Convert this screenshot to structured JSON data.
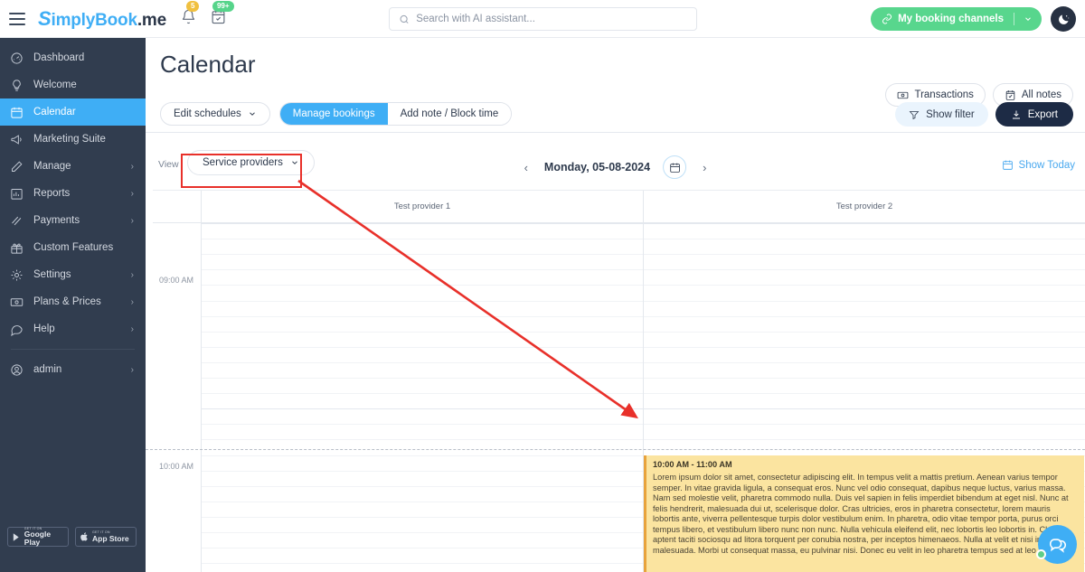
{
  "topbar": {
    "menu_icon": "hamburger-icon",
    "brand_s": "S",
    "brand_part1": "implyBook",
    "brand_part2": ".me",
    "bell_badge": "5",
    "calendar_badge": "99+",
    "search": {
      "placeholder": "Search with AI assistant...",
      "value": ""
    },
    "booking_channels_label": "My booking channels",
    "theme_toggle_icon": "moon-icon"
  },
  "sidebar": {
    "items": [
      {
        "label": "Dashboard",
        "icon": "gauge-icon",
        "active": false,
        "chevron": false
      },
      {
        "label": "Welcome",
        "icon": "bulb-icon",
        "active": false,
        "chevron": false
      },
      {
        "label": "Calendar",
        "icon": "calendar-icon",
        "active": true,
        "chevron": false
      },
      {
        "label": "Marketing Suite",
        "icon": "megaphone-icon",
        "active": false,
        "chevron": false
      },
      {
        "label": "Manage",
        "icon": "pencil-icon",
        "active": false,
        "chevron": true
      },
      {
        "label": "Reports",
        "icon": "chart-icon",
        "active": false,
        "chevron": true
      },
      {
        "label": "Payments",
        "icon": "coins-icon",
        "active": false,
        "chevron": true
      },
      {
        "label": "Custom Features",
        "icon": "gift-icon",
        "active": false,
        "chevron": false
      },
      {
        "label": "Settings",
        "icon": "gear-icon",
        "active": false,
        "chevron": true
      },
      {
        "label": "Plans & Prices",
        "icon": "money-icon",
        "active": false,
        "chevron": true
      },
      {
        "label": "Help",
        "icon": "chat-icon",
        "active": false,
        "chevron": true
      }
    ],
    "account": {
      "label": "admin",
      "icon": "user-icon",
      "chevron": true
    },
    "stores": [
      {
        "small": "GET IT ON",
        "name": "Google Play",
        "icon": "play-store-icon"
      },
      {
        "small": "GET IT ON",
        "name": "App Store",
        "icon": "apple-icon"
      }
    ]
  },
  "header": {
    "title": "Calendar",
    "transactions_label": "Transactions",
    "all_notes_label": "All notes"
  },
  "toolbar": {
    "edit_schedules_label": "Edit schedules",
    "segments": [
      {
        "label": "Manage bookings",
        "active": true
      },
      {
        "label": "Add note / Block time",
        "active": false
      }
    ],
    "show_filter_label": "Show filter",
    "export_label": "Export"
  },
  "viewrow": {
    "view_label": "View",
    "view_value": "Service providers",
    "date_text": "Monday, 05-08-2024",
    "prev_icon": "chevron-left-icon",
    "next_icon": "chevron-right-icon",
    "calendar_picker_icon": "calendar-icon",
    "show_today_label": "Show Today",
    "show_today_icon": "calendar-today-icon"
  },
  "calendar": {
    "columns": [
      {
        "label": "Test provider 1"
      },
      {
        "label": "Test provider 2"
      }
    ],
    "time_labels": [
      "09:00 AM",
      "10:00 AM"
    ],
    "events": [
      {
        "time": "10:00 AM - 11:00 AM",
        "description": "Lorem ipsum dolor sit amet, consectetur adipiscing elit. In tempus velit a mattis pretium. Aenean varius tempor semper. In vitae gravida ligula, a consequat eros. Nunc vel odio consequat, dapibus neque luctus, varius massa. Nam sed molestie velit, pharetra commodo nulla. Duis vel sapien in felis imperdiet bibendum at eget nisl. Nunc at felis hendrerit, malesuada dui ut, scelerisque dolor. Cras ultricies, eros in pharetra consectetur, lorem mauris lobortis ante, viverra pellentesque turpis dolor vestibulum enim. In pharetra, odio vitae tempor porta, purus orci tempus libero, et vestibulum libero nunc non nunc. Nulla vehicula eleifend elit, nec lobortis leo lobortis in. Class aptent taciti sociosqu ad litora torquent per conubia nostra, per inceptos himenaeos. Nulla at velit et nisi interdum malesuada. Morbi ut consequat massa, eu pulvinar nisi. Donec eu velit in leo pharetra tempus sed at leo.",
        "column": 2,
        "bg_color": "#fbe4a0",
        "accent_color": "#e8a33d"
      }
    ]
  },
  "annotation": {
    "highlight_color": "#e8302a",
    "target": "view-select"
  },
  "chat_widget": {
    "icon": "chat-bubbles-icon",
    "status_color": "#5fce88"
  }
}
